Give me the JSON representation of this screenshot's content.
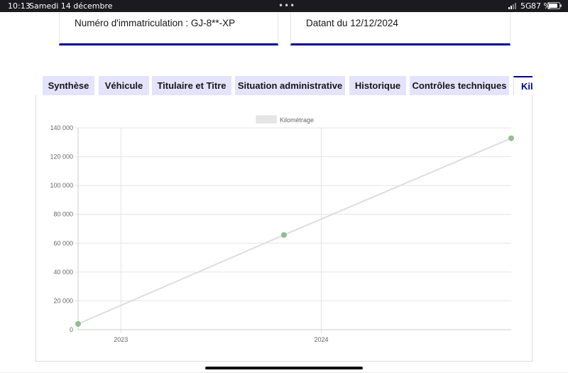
{
  "status_bar": {
    "time": "10:13",
    "date": "Samedi 14 décembre",
    "network": "5G",
    "battery": "87 %",
    "battery_level": 0.87
  },
  "cards": {
    "registration": "Numéro d'immatriculation : GJ-8**-XP",
    "dated": "Datant du 12/12/2024"
  },
  "tabs": [
    {
      "label": "Synthèse"
    },
    {
      "label": "Véhicule"
    },
    {
      "label": "Titulaire et Titre"
    },
    {
      "label": "Situation administrative"
    },
    {
      "label": "Historique"
    },
    {
      "label": "Contrôles techniques"
    },
    {
      "label": "Kilométrage",
      "active": true
    }
  ],
  "chart_data": {
    "type": "line",
    "legend": "Kilométrage",
    "legend_position": "top-center",
    "x_tick_labels": [
      "2023",
      "2024"
    ],
    "y_tick_labels": [
      "0",
      "20 000",
      "40 000",
      "60 000",
      "80 000",
      "100 000",
      "120 000",
      "140 000"
    ],
    "ylim": [
      0,
      140000
    ],
    "grid": true,
    "series": [
      {
        "name": "Kilométrage",
        "line_color": "#dddddd",
        "point_color": "#8fbf8f",
        "points": [
          {
            "x": "2022-10-15",
            "y": 4000
          },
          {
            "x": "2023-10-25",
            "y": 65700
          },
          {
            "x": "2024-12-12",
            "y": 132800
          }
        ]
      }
    ]
  }
}
